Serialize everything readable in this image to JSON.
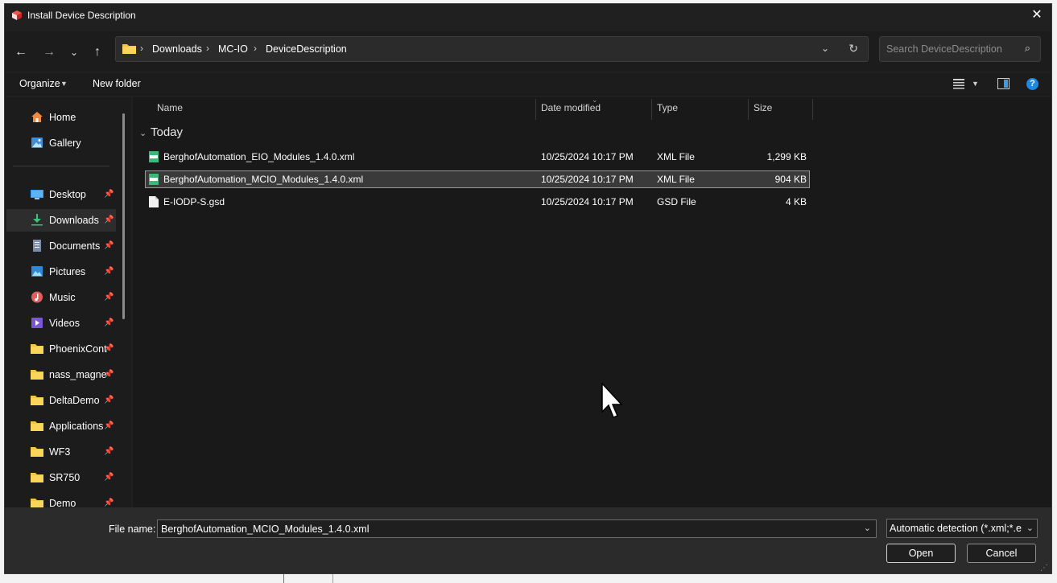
{
  "window": {
    "title": "Install Device Description"
  },
  "nav": {
    "breadcrumb": [
      "Downloads",
      "MC-IO",
      "DeviceDescription"
    ],
    "search_placeholder": "Search DeviceDescription"
  },
  "commands": {
    "organize": "Organize",
    "new_folder": "New folder"
  },
  "sidebar": {
    "quick": [
      {
        "label": "Home",
        "icon": "home-icon"
      },
      {
        "label": "Gallery",
        "icon": "gallery-icon"
      }
    ],
    "pinned": [
      {
        "label": "Desktop",
        "icon": "desktop-icon"
      },
      {
        "label": "Downloads",
        "icon": "download-icon"
      },
      {
        "label": "Documents",
        "icon": "documents-icon"
      },
      {
        "label": "Pictures",
        "icon": "pictures-icon"
      },
      {
        "label": "Music",
        "icon": "music-icon"
      },
      {
        "label": "Videos",
        "icon": "videos-icon"
      },
      {
        "label": "PhoenixContact",
        "icon": "folder-icon"
      },
      {
        "label": "nass_magnet",
        "icon": "folder-icon"
      },
      {
        "label": "DeltaDemo",
        "icon": "folder-icon"
      },
      {
        "label": "Applications",
        "icon": "folder-icon"
      },
      {
        "label": "WF3",
        "icon": "folder-icon"
      },
      {
        "label": "SR750",
        "icon": "folder-icon"
      },
      {
        "label": "Demo",
        "icon": "folder-icon"
      }
    ]
  },
  "columns": {
    "name": "Name",
    "date": "Date modified",
    "type": "Type",
    "size": "Size"
  },
  "group": "Today",
  "files": [
    {
      "name": "BerghofAutomation_EIO_Modules_1.4.0.xml",
      "date": "10/25/2024 10:17 PM",
      "type": "XML File",
      "size": "1,299 KB",
      "icon": "xml-file-icon"
    },
    {
      "name": "BerghofAutomation_MCIO_Modules_1.4.0.xml",
      "date": "10/25/2024 10:17 PM",
      "type": "XML File",
      "size": "904 KB",
      "icon": "xml-file-icon"
    },
    {
      "name": "E-IODP-S.gsd",
      "date": "10/25/2024 10:17 PM",
      "type": "GSD File",
      "size": "4 KB",
      "icon": "file-icon"
    }
  ],
  "bottom": {
    "filename_label": "File name:",
    "filename_value": "BerghofAutomation_MCIO_Modules_1.4.0.xml",
    "filter_value": "Automatic detection (*.xml;*.ed",
    "open_label": "Open",
    "cancel_label": "Cancel"
  }
}
